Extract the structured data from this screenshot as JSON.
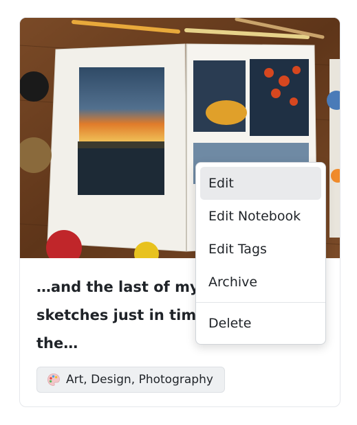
{
  "card": {
    "image_alt": "Open sketchbook with watercolor night scenes",
    "title": "…and the last of my sketches just in time! the…",
    "title_lines": [
      "…and the last of my",
      "sketches just in time!",
      "the…"
    ],
    "tag": {
      "icon": "palette-icon",
      "label": "Art, Design, Photography"
    }
  },
  "menu": {
    "items": [
      {
        "label": "Edit",
        "active": true
      },
      {
        "label": "Edit Notebook"
      },
      {
        "label": "Edit Tags"
      },
      {
        "label": "Archive"
      }
    ],
    "danger_items": [
      {
        "label": "Delete"
      }
    ]
  },
  "colors": {
    "active_item_bg": "#e9eaec",
    "text": "#1f2328",
    "tag_bg": "#eef0f2"
  }
}
